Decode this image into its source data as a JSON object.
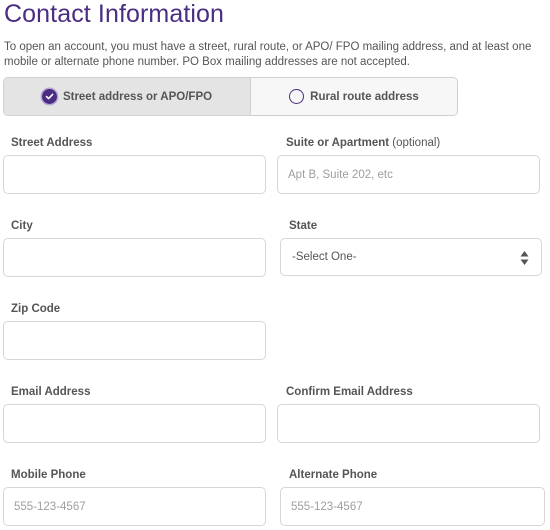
{
  "page": {
    "title": "Contact Information",
    "intro": "To open an account, you must have a street, rural route, or APO/ FPO mailing address, and at least one mobile or alternate phone number. PO Box mailing addresses are not accepted."
  },
  "address_type": {
    "options": [
      {
        "label": "Street address or APO/FPO",
        "selected": true
      },
      {
        "label": "Rural route address",
        "selected": false
      }
    ]
  },
  "fields": {
    "street_address": {
      "label": "Street Address",
      "value": "",
      "placeholder": ""
    },
    "suite": {
      "label": "Suite or Apartment",
      "label_suffix": "(optional)",
      "value": "",
      "placeholder": "Apt B, Suite 202, etc"
    },
    "city": {
      "label": "City",
      "value": "",
      "placeholder": ""
    },
    "state": {
      "label": "State",
      "selected": "-Select One-"
    },
    "zip": {
      "label": "Zip Code",
      "value": "",
      "placeholder": ""
    },
    "email": {
      "label": "Email Address",
      "value": "",
      "placeholder": ""
    },
    "confirm_email": {
      "label": "Confirm Email Address",
      "value": "",
      "placeholder": ""
    },
    "mobile_phone": {
      "label": "Mobile Phone",
      "value": "",
      "placeholder": "555-123-4567"
    },
    "alternate_phone": {
      "label": "Alternate Phone",
      "value": "",
      "placeholder": "555-123-4567"
    }
  },
  "colors": {
    "accent": "#4a2d82",
    "text": "#555555",
    "border": "#d6d6d6"
  }
}
